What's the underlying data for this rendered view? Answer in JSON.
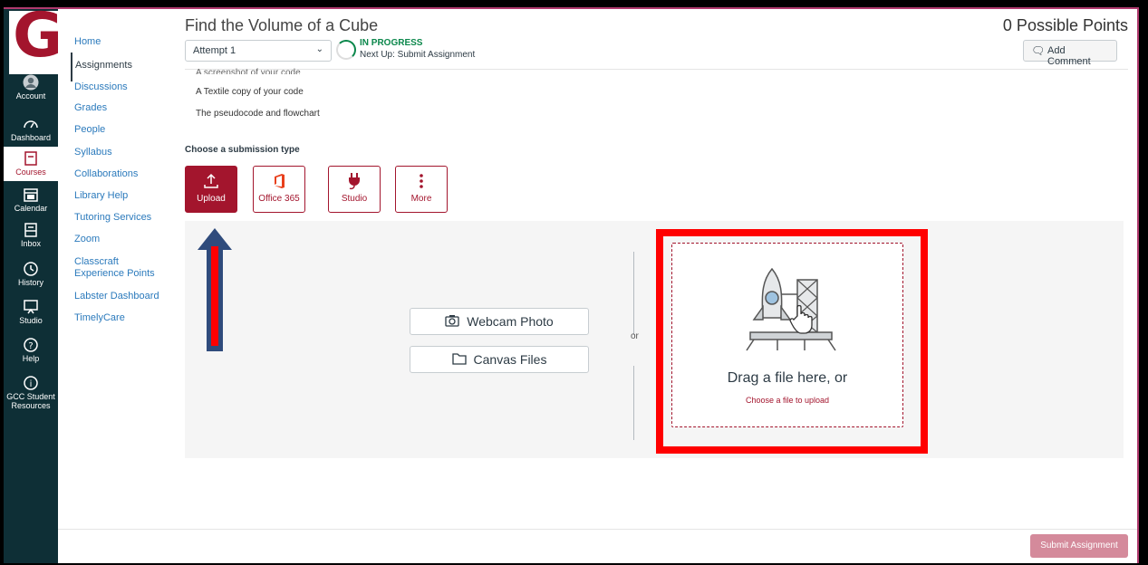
{
  "global_nav": {
    "logo_letter": "G",
    "items": [
      {
        "label": "Account",
        "icon": "account-icon"
      },
      {
        "label": "Dashboard",
        "icon": "dashboard-icon"
      },
      {
        "label": "Courses",
        "icon": "courses-icon"
      },
      {
        "label": "Calendar",
        "icon": "calendar-icon"
      },
      {
        "label": "Inbox",
        "icon": "inbox-icon"
      },
      {
        "label": "History",
        "icon": "history-icon"
      },
      {
        "label": "Studio",
        "icon": "studio-icon"
      },
      {
        "label": "Help",
        "icon": "help-icon"
      },
      {
        "label": "GCC Student Resources",
        "label_line1": "GCC Student",
        "label_line2": "Resources",
        "icon": "info-icon"
      }
    ]
  },
  "course_nav": {
    "items": [
      "Home",
      "Assignments",
      "Discussions",
      "Grades",
      "People",
      "Syllabus",
      "Collaborations",
      "Library Help",
      "Tutoring Services",
      "Zoom",
      "Classcraft Experience Points",
      "Labster Dashboard",
      "TimelyCare"
    ],
    "active": "Assignments"
  },
  "header": {
    "title": "Find the Volume of a Cube",
    "points": "0 Possible Points",
    "attempt": "Attempt 1",
    "status": "IN PROGRESS",
    "next_up": "Next Up: Submit Assignment",
    "add_comment": "Add Comment"
  },
  "requirements": {
    "clipped": "A screenshot of your code",
    "items": [
      "A Textile copy of your code",
      "The pseudocode and flowchart"
    ]
  },
  "submission": {
    "choose_label": "Choose a submission type",
    "types": [
      {
        "label": "Upload",
        "icon": "upload-icon"
      },
      {
        "label": "Office 365",
        "icon": "office365-icon"
      },
      {
        "label": "Studio",
        "icon": "studio-plug-icon"
      },
      {
        "label": "More",
        "icon": "more-icon"
      }
    ],
    "active": "Upload"
  },
  "upload_panel": {
    "webcam": "Webcam Photo",
    "canvas_files": "Canvas Files",
    "or": "or",
    "drag": "Drag a file here, or",
    "choose": "Choose a file to upload"
  },
  "footer": {
    "submit": "Submit Assignment"
  },
  "colors": {
    "brand": "#a3152d",
    "nav_bg": "#0e2f36",
    "link": "#2b7abc",
    "status_green": "#0b874b",
    "highlight_red": "#ff0000",
    "arrow_blue": "#2f4b7c"
  }
}
